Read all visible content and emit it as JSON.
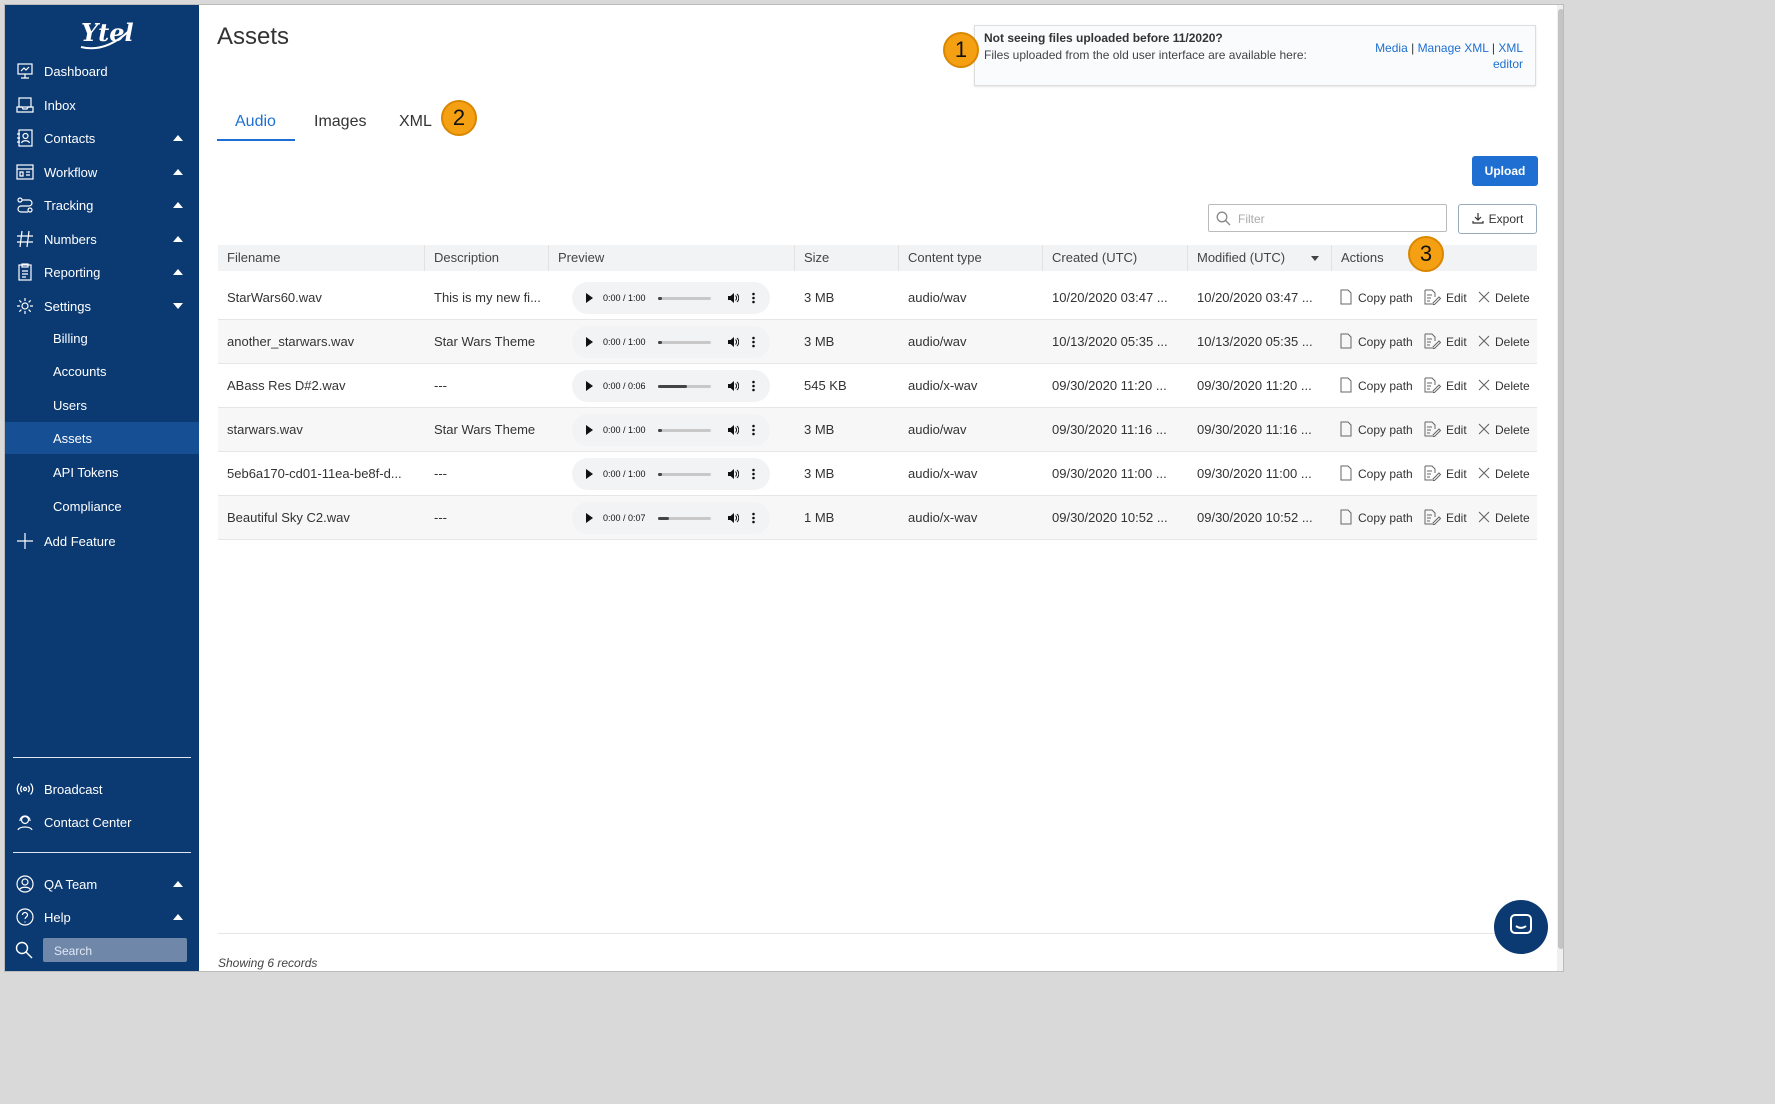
{
  "sidebar": {
    "logo_text": "Ytel",
    "items": [
      {
        "label": "Dashboard",
        "icon": "dashboard-icon"
      },
      {
        "label": "Inbox",
        "icon": "inbox-icon"
      },
      {
        "label": "Contacts",
        "icon": "contacts-icon",
        "caret": "up"
      },
      {
        "label": "Workflow",
        "icon": "workflow-icon",
        "caret": "up"
      },
      {
        "label": "Tracking",
        "icon": "tracking-icon",
        "caret": "up"
      },
      {
        "label": "Numbers",
        "icon": "hash-icon",
        "caret": "up"
      },
      {
        "label": "Reporting",
        "icon": "reporting-icon",
        "caret": "up"
      },
      {
        "label": "Settings",
        "icon": "gear-icon",
        "caret": "down"
      }
    ],
    "settings_sub": [
      "Billing",
      "Accounts",
      "Users",
      "Assets",
      "API Tokens",
      "Compliance"
    ],
    "active_sub": "Assets",
    "add_feature": "Add Feature",
    "bottom_items": [
      {
        "label": "Broadcast",
        "icon": "broadcast-icon"
      },
      {
        "label": "Contact Center",
        "icon": "headset-icon"
      }
    ],
    "team": "QA Team",
    "help": "Help",
    "search_placeholder": "Search"
  },
  "header": {
    "title": "Assets"
  },
  "notice": {
    "title": "Not seeing files uploaded before 11/2020?",
    "message": "Files uploaded from the old user interface are available here:",
    "links": [
      "Media",
      "Manage XML",
      "XML editor"
    ],
    "separator": "|"
  },
  "markers": [
    "1",
    "2",
    "3"
  ],
  "tabs": [
    {
      "label": "Audio",
      "active": true
    },
    {
      "label": "Images",
      "active": false
    },
    {
      "label": "XML",
      "active": false
    }
  ],
  "toolbar": {
    "upload_label": "Upload",
    "filter_placeholder": "Filter",
    "export_label": "Export"
  },
  "table": {
    "columns": [
      "Filename",
      "Description",
      "Preview",
      "Size",
      "Content type",
      "Created (UTC)",
      "Modified (UTC)",
      "Actions"
    ],
    "sort_column": "Modified (UTC)",
    "actions": {
      "copy": "Copy path",
      "edit": "Edit",
      "delete": "Delete"
    },
    "rows": [
      {
        "filename": "StarWars60.wav",
        "description": "This is my new fi...",
        "time": "0:00 / 1:00",
        "progress": 0.08,
        "size": "3 MB",
        "content_type": "audio/wav",
        "created": "10/20/2020 03:47 ...",
        "modified": "10/20/2020 03:47 ..."
      },
      {
        "filename": "another_starwars.wav",
        "description": "Star Wars Theme",
        "time": "0:00 / 1:00",
        "progress": 0.08,
        "size": "3 MB",
        "content_type": "audio/wav",
        "created": "10/13/2020 05:35 ...",
        "modified": "10/13/2020 05:35 ..."
      },
      {
        "filename": "ABass Res D#2.wav",
        "description": "---",
        "time": "0:00 / 0:06",
        "progress": 0.55,
        "size": "545 KB",
        "content_type": "audio/x-wav",
        "created": "09/30/2020 11:20 ...",
        "modified": "09/30/2020 11:20 ..."
      },
      {
        "filename": "starwars.wav",
        "description": "Star Wars Theme",
        "time": "0:00 / 1:00",
        "progress": 0.08,
        "size": "3 MB",
        "content_type": "audio/wav",
        "created": "09/30/2020 11:16 ...",
        "modified": "09/30/2020 11:16 ..."
      },
      {
        "filename": "5eb6a170-cd01-11ea-be8f-d...",
        "description": "---",
        "time": "0:00 / 1:00",
        "progress": 0.08,
        "size": "3 MB",
        "content_type": "audio/x-wav",
        "created": "09/30/2020 11:00 ...",
        "modified": "09/30/2020 11:00 ..."
      },
      {
        "filename": "Beautiful Sky C2.wav",
        "description": "---",
        "time": "0:00 / 0:07",
        "progress": 0.2,
        "size": "1 MB",
        "content_type": "audio/x-wav",
        "created": "09/30/2020 10:52 ...",
        "modified": "09/30/2020 10:52 ..."
      }
    ]
  },
  "footer": {
    "records_text": "Showing 6 records"
  },
  "colors": {
    "sidebar_bg": "#0b3a73",
    "accent": "#1e6fd1",
    "marker": "#f4a012"
  }
}
